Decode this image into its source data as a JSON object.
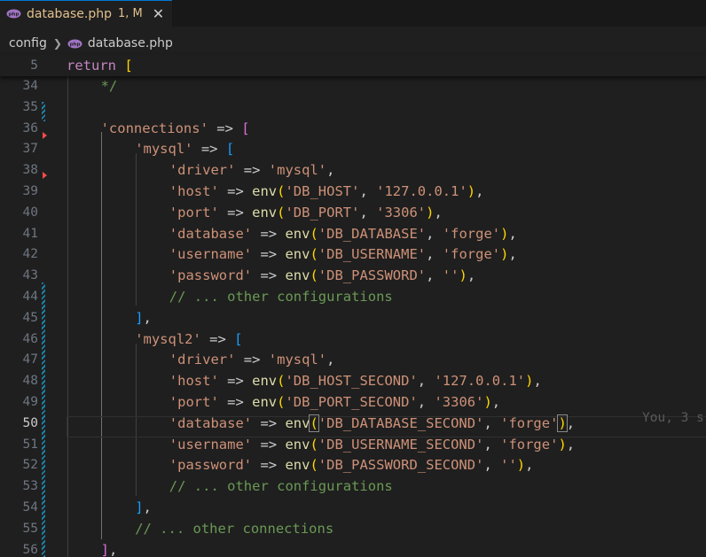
{
  "tab": {
    "filename": "database.php",
    "status": "1, M",
    "close": "✕"
  },
  "breadcrumb": {
    "folder": "config",
    "file": "database.php"
  },
  "sticky": {
    "line_number": "5",
    "keyword": "return",
    "bracket": "["
  },
  "editor": {
    "current_line": "50",
    "blame": "You, 3 s",
    "lines": [
      {
        "n": "34",
        "t": [
          [
            "*/",
            "c"
          ]
        ]
      },
      {
        "n": "35",
        "t": []
      },
      {
        "n": "36",
        "t": [
          [
            "'connections'",
            "s"
          ],
          [
            " => ",
            "p"
          ],
          [
            "[",
            "b2"
          ]
        ]
      },
      {
        "n": "37",
        "t": [
          [
            "'mysql'",
            "s"
          ],
          [
            " => ",
            "p"
          ],
          [
            "[",
            "b3"
          ]
        ]
      },
      {
        "n": "38",
        "t": [
          [
            "'driver'",
            "s"
          ],
          [
            " => ",
            "p"
          ],
          [
            "'mysql'",
            "s"
          ],
          [
            ",",
            "p"
          ]
        ]
      },
      {
        "n": "39",
        "t": [
          [
            "'host'",
            "s"
          ],
          [
            " => ",
            "p"
          ],
          [
            "env",
            "f"
          ],
          [
            "(",
            "b1"
          ],
          [
            "'DB_HOST'",
            "s"
          ],
          [
            ", ",
            "p"
          ],
          [
            "'127.0.0.1'",
            "s"
          ],
          [
            ")",
            "b1"
          ],
          [
            ",",
            "p"
          ]
        ]
      },
      {
        "n": "40",
        "t": [
          [
            "'port'",
            "s"
          ],
          [
            " => ",
            "p"
          ],
          [
            "env",
            "f"
          ],
          [
            "(",
            "b1"
          ],
          [
            "'DB_PORT'",
            "s"
          ],
          [
            ", ",
            "p"
          ],
          [
            "'3306'",
            "s"
          ],
          [
            ")",
            "b1"
          ],
          [
            ",",
            "p"
          ]
        ]
      },
      {
        "n": "41",
        "t": [
          [
            "'database'",
            "s"
          ],
          [
            " => ",
            "p"
          ],
          [
            "env",
            "f"
          ],
          [
            "(",
            "b1"
          ],
          [
            "'DB_DATABASE'",
            "s"
          ],
          [
            ", ",
            "p"
          ],
          [
            "'forge'",
            "s"
          ],
          [
            ")",
            "b1"
          ],
          [
            ",",
            "p"
          ]
        ]
      },
      {
        "n": "42",
        "t": [
          [
            "'username'",
            "s"
          ],
          [
            " => ",
            "p"
          ],
          [
            "env",
            "f"
          ],
          [
            "(",
            "b1"
          ],
          [
            "'DB_USERNAME'",
            "s"
          ],
          [
            ", ",
            "p"
          ],
          [
            "'forge'",
            "s"
          ],
          [
            ")",
            "b1"
          ],
          [
            ",",
            "p"
          ]
        ]
      },
      {
        "n": "43",
        "t": [
          [
            "'password'",
            "s"
          ],
          [
            " => ",
            "p"
          ],
          [
            "env",
            "f"
          ],
          [
            "(",
            "b1"
          ],
          [
            "'DB_PASSWORD'",
            "s"
          ],
          [
            ", ",
            "p"
          ],
          [
            "''",
            "s"
          ],
          [
            ")",
            "b1"
          ],
          [
            ",",
            "p"
          ]
        ]
      },
      {
        "n": "44",
        "t": [
          [
            "// ... other configurations",
            "c"
          ]
        ]
      },
      {
        "n": "45",
        "t": [
          [
            "]",
            "b3"
          ],
          [
            ",",
            "p"
          ]
        ]
      },
      {
        "n": "46",
        "t": [
          [
            "'mysql2'",
            "s"
          ],
          [
            " => ",
            "p"
          ],
          [
            "[",
            "b3"
          ]
        ]
      },
      {
        "n": "47",
        "t": [
          [
            "'driver'",
            "s"
          ],
          [
            " => ",
            "p"
          ],
          [
            "'mysql'",
            "s"
          ],
          [
            ",",
            "p"
          ]
        ]
      },
      {
        "n": "48",
        "t": [
          [
            "'host'",
            "s"
          ],
          [
            " => ",
            "p"
          ],
          [
            "env",
            "f"
          ],
          [
            "(",
            "b1"
          ],
          [
            "'DB_HOST_SECOND'",
            "s"
          ],
          [
            ", ",
            "p"
          ],
          [
            "'127.0.0.1'",
            "s"
          ],
          [
            ")",
            "b1"
          ],
          [
            ",",
            "p"
          ]
        ]
      },
      {
        "n": "49",
        "t": [
          [
            "'port'",
            "s"
          ],
          [
            " => ",
            "p"
          ],
          [
            "env",
            "f"
          ],
          [
            "(",
            "b1"
          ],
          [
            "'DB_PORT_SECOND'",
            "s"
          ],
          [
            ", ",
            "p"
          ],
          [
            "'3306'",
            "s"
          ],
          [
            ")",
            "b1"
          ],
          [
            ",",
            "p"
          ]
        ]
      },
      {
        "n": "50",
        "t": [
          [
            "'database'",
            "s"
          ],
          [
            " => ",
            "p"
          ],
          [
            "env",
            "f"
          ],
          [
            "(",
            "b1 cursor-box"
          ],
          [
            "'DB_DATABASE_SECOND'",
            "s"
          ],
          [
            ", ",
            "p"
          ],
          [
            "'forge'",
            "s"
          ],
          [
            ")",
            "b1 cursor-box"
          ],
          [
            ",",
            "p"
          ]
        ]
      },
      {
        "n": "51",
        "t": [
          [
            "'username'",
            "s"
          ],
          [
            " => ",
            "p"
          ],
          [
            "env",
            "f"
          ],
          [
            "(",
            "b1"
          ],
          [
            "'DB_USERNAME_SECOND'",
            "s"
          ],
          [
            ", ",
            "p"
          ],
          [
            "'forge'",
            "s"
          ],
          [
            ")",
            "b1"
          ],
          [
            ",",
            "p"
          ]
        ]
      },
      {
        "n": "52",
        "t": [
          [
            "'password'",
            "s"
          ],
          [
            " => ",
            "p"
          ],
          [
            "env",
            "f"
          ],
          [
            "(",
            "b1"
          ],
          [
            "'DB_PASSWORD_SECOND'",
            "s"
          ],
          [
            ", ",
            "p"
          ],
          [
            "''",
            "s"
          ],
          [
            ")",
            "b1"
          ],
          [
            ",",
            "p"
          ]
        ]
      },
      {
        "n": "53",
        "t": [
          [
            "// ... other configurations",
            "c"
          ]
        ]
      },
      {
        "n": "54",
        "t": [
          [
            "]",
            "b3"
          ],
          [
            ",",
            "p"
          ]
        ]
      },
      {
        "n": "55",
        "t": [
          [
            "// ... other connections",
            "c"
          ]
        ]
      },
      {
        "n": "56",
        "t": [
          [
            "]",
            "b2"
          ],
          [
            ",",
            "p"
          ]
        ]
      }
    ]
  }
}
